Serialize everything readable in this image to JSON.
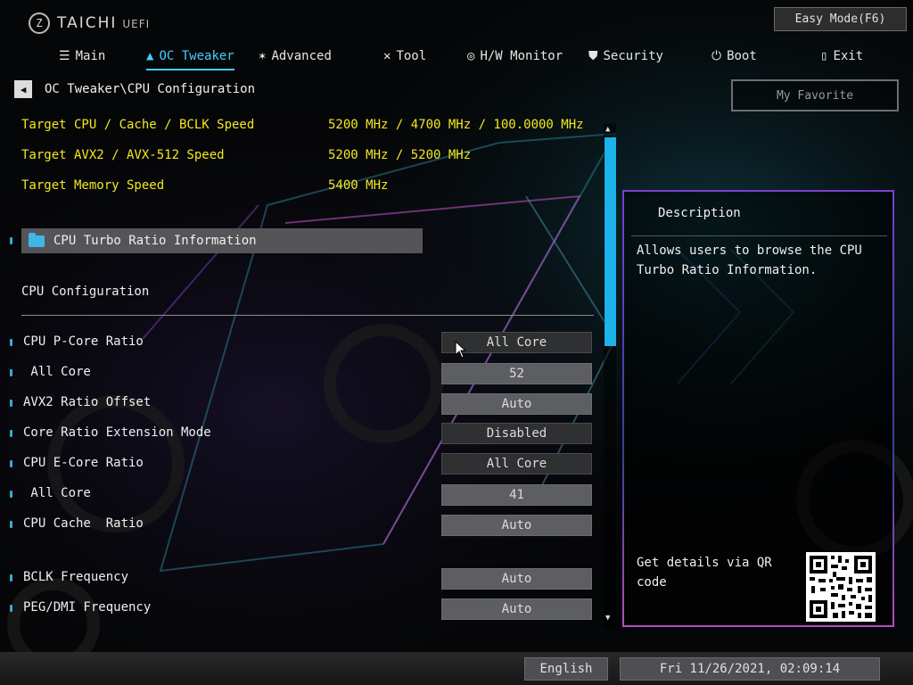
{
  "brand": {
    "name": "TAICHI",
    "suffix": "UEFI",
    "logo_icon": "gear-logo-icon"
  },
  "easy_mode_label": "Easy Mode(F6)",
  "nav": [
    {
      "label": "Main",
      "icon": "list-icon",
      "active": false
    },
    {
      "label": "OC Tweaker",
      "icon": "rocket-icon",
      "active": true
    },
    {
      "label": "Advanced",
      "icon": "star-icon",
      "active": false
    },
    {
      "label": "Tool",
      "icon": "tools-icon",
      "active": false
    },
    {
      "label": "H/W Monitor",
      "icon": "crosshair-icon",
      "active": false
    },
    {
      "label": "Security",
      "icon": "shield-icon",
      "active": false
    },
    {
      "label": "Boot",
      "icon": "power-icon",
      "active": false
    },
    {
      "label": "Exit",
      "icon": "exit-door-icon",
      "active": false
    }
  ],
  "breadcrumb": "OC Tweaker\\CPU Configuration",
  "my_favorite": "My Favorite",
  "info": [
    {
      "label": "Target CPU / Cache / BCLK Speed",
      "value": "5200 MHz / 4700 MHz / 100.0000 MHz"
    },
    {
      "label": "Target AVX2 / AVX-512 Speed",
      "value": "5200 MHz / 5200 MHz"
    },
    {
      "label": "Target Memory Speed",
      "value": "5400 MHz"
    }
  ],
  "submenu": {
    "label": "CPU Turbo Ratio Information",
    "icon": "folder-icon"
  },
  "section_title": "CPU Configuration",
  "options": [
    {
      "label": "CPU P-Core Ratio",
      "value": "All Core",
      "style": "dark"
    },
    {
      "label": " All Core",
      "value": "52",
      "style": "gray"
    },
    {
      "label": "AVX2 Ratio Offset",
      "value": "Auto",
      "style": "gray"
    },
    {
      "label": "Core Ratio Extension Mode",
      "value": "Disabled",
      "style": "dark"
    },
    {
      "label": "CPU E-Core Ratio",
      "value": "All Core",
      "style": "dark"
    },
    {
      "label": " All Core",
      "value": "41",
      "style": "gray"
    },
    {
      "label": "CPU Cache  Ratio",
      "value": "Auto",
      "style": "gray"
    },
    {
      "label": "BCLK Frequency",
      "value": "Auto",
      "style": "gray"
    },
    {
      "label": "PEG/DMI Frequency",
      "value": "Auto",
      "style": "gray"
    }
  ],
  "description": {
    "title": "Description",
    "text": "Allows users to browse the CPU Turbo Ratio Information.",
    "qr_text": "Get details via QR code"
  },
  "footer": {
    "language": "English",
    "datetime": "Fri 11/26/2021, 02:09:14"
  },
  "colors": {
    "accent": "#3fd0ff",
    "info_text": "#f2e81e",
    "scrollbar": "#1db3ea"
  }
}
